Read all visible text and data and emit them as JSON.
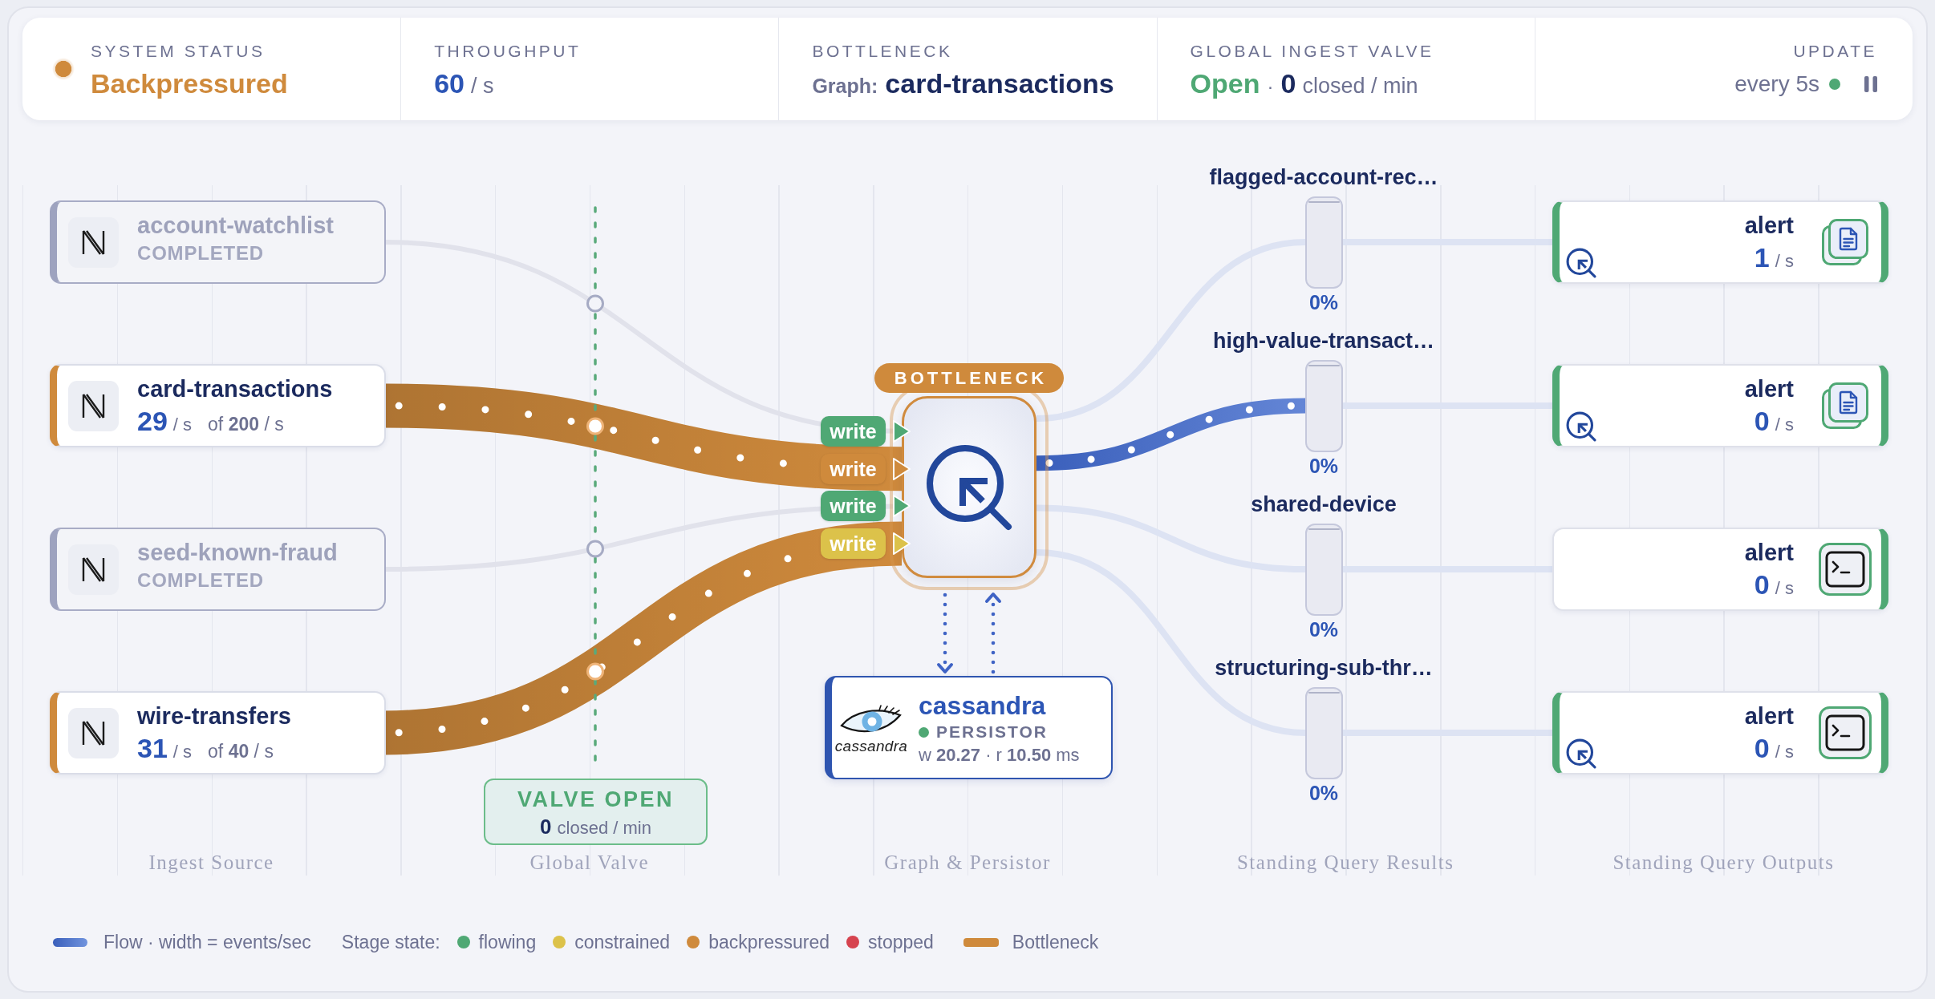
{
  "header": {
    "status": {
      "label": "SYSTEM STATUS",
      "value": "Backpressured",
      "color": "#cf8a3c"
    },
    "throughput": {
      "label": "THROUGHPUT",
      "value": "60",
      "unit": "/ s"
    },
    "bottleneck": {
      "label": "BOTTLENECK",
      "prefix": "Graph:",
      "value": "card-transactions"
    },
    "valve": {
      "label": "GLOBAL INGEST VALVE",
      "value": "Open",
      "open": true,
      "separator": "·",
      "count": "0",
      "unit": "closed / min"
    },
    "update": {
      "label": "UPDATE",
      "value": "every 5s",
      "live": true
    }
  },
  "sources": [
    {
      "name": "account-watchlist",
      "completed": true,
      "status": "COMPLETED",
      "color": "#9ea3bf",
      "write": {
        "label": "write",
        "color": "#4fa874"
      }
    },
    {
      "name": "card-transactions",
      "completed": false,
      "rate": "29",
      "rate_unit": "/ s",
      "limit": "of **200** / s",
      "color": "#cf8a3c",
      "write": {
        "label": "write",
        "color": "#cf8a3c"
      }
    },
    {
      "name": "seed-known-fraud",
      "completed": true,
      "status": "COMPLETED",
      "color": "#9ea3bf",
      "write": {
        "label": "write",
        "color": "#4fa874"
      }
    },
    {
      "name": "wire-transfers",
      "completed": false,
      "rate": "31",
      "rate_unit": "/ s",
      "limit": "of **40** / s",
      "color": "#cf8a3c",
      "write": {
        "label": "write",
        "color": "#dcc24a"
      }
    }
  ],
  "valve": {
    "title": "VALVE OPEN",
    "open": true,
    "count": "0",
    "unit": "closed / min"
  },
  "graph": {
    "badge": "BOTTLENECK",
    "bottleneck": true
  },
  "persistor": {
    "logo_text": "cassandra",
    "name": "cassandra",
    "role": "PERSISTOR",
    "color": "#4fa874",
    "latency": "w **20.27** · r **10.50** ms"
  },
  "results": [
    {
      "name": "flagged-account-rec…",
      "level": 0,
      "reading": "0%",
      "active": false
    },
    {
      "name": "high-value-transact…",
      "level": 0,
      "reading": "0%",
      "active": true
    },
    {
      "name": "shared-device",
      "level": 0,
      "reading": "0%",
      "active": false
    },
    {
      "name": "structuring-sub-thr…",
      "level": 0,
      "reading": "0%",
      "active": false
    }
  ],
  "outputs": [
    {
      "name": "alert",
      "rate": "1",
      "unit": "/ s",
      "kind": "document",
      "query_marker": true,
      "color": "#4fa874"
    },
    {
      "name": "alert",
      "rate": "0",
      "unit": "/ s",
      "kind": "document",
      "query_marker": true,
      "color": "#4fa874"
    },
    {
      "name": "alert",
      "rate": "0",
      "unit": "/ s",
      "kind": "terminal",
      "query_marker": false,
      "color": "#4fa874"
    },
    {
      "name": "alert",
      "rate": "0",
      "unit": "/ s",
      "kind": "terminal",
      "query_marker": true,
      "color": "#4fa874"
    }
  ],
  "columns": [
    "Ingest Source",
    "Global Valve",
    "Graph & Persistor",
    "Standing Query Results",
    "Standing Query Outputs"
  ],
  "legend": {
    "flow": {
      "label": "Flow · width = events/sec",
      "color": "#3a5fbb"
    },
    "states_label": "Stage state:",
    "states": [
      {
        "label": "flowing",
        "color": "#4fa874"
      },
      {
        "label": "constrained",
        "color": "#dcc24a"
      },
      {
        "label": "backpressured",
        "color": "#cf8a3c"
      },
      {
        "label": "stopped",
        "color": "#d6434f"
      }
    ],
    "bottleneck": {
      "label": "Bottleneck",
      "color": "#cf8a3c"
    }
  }
}
